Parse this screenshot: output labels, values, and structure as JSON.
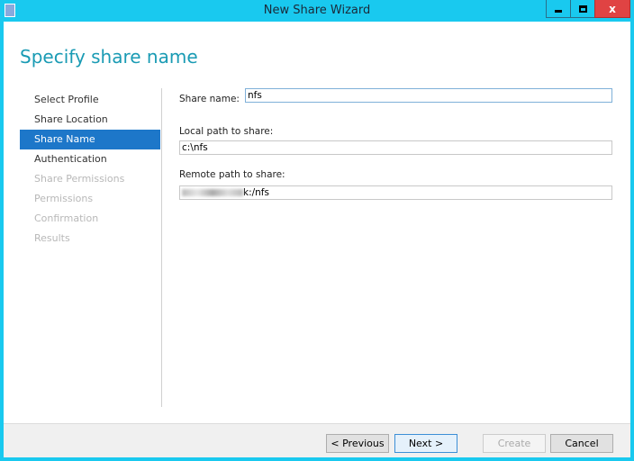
{
  "window": {
    "title": "New Share Wizard",
    "icon": "share-wizard-icon",
    "controls": [
      "minimize",
      "maximize",
      "close"
    ],
    "close_label": "x"
  },
  "page": {
    "heading": "Specify share name"
  },
  "nav": {
    "items": [
      {
        "label": "Select Profile",
        "state": "done"
      },
      {
        "label": "Share Location",
        "state": "done"
      },
      {
        "label": "Share Name",
        "state": "active"
      },
      {
        "label": "Authentication",
        "state": "enabled"
      },
      {
        "label": "Share Permissions",
        "state": "disabled"
      },
      {
        "label": "Permissions",
        "state": "disabled"
      },
      {
        "label": "Confirmation",
        "state": "disabled"
      },
      {
        "label": "Results",
        "state": "disabled"
      }
    ]
  },
  "form": {
    "share_name_label": "Share name:",
    "share_name_value": "nfs",
    "local_path_label": "Local path to share:",
    "local_path_value": "c:\\nfs",
    "remote_path_label": "Remote path to share:",
    "remote_path_value": "k:/nfs"
  },
  "footer": {
    "previous": "< Previous",
    "next": "Next >",
    "create": "Create",
    "cancel": "Cancel"
  },
  "colors": {
    "accent": "#19c9ef",
    "selection": "#1d77c9",
    "heading": "#1a9bb4",
    "close": "#e04343"
  }
}
